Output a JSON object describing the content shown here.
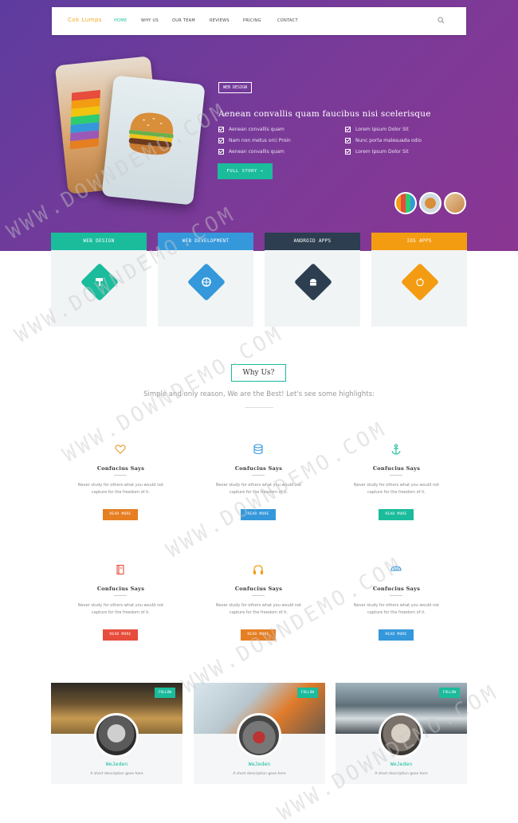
{
  "nav": {
    "logo": "Cok Lumps",
    "items": [
      "HOME",
      "WHY US",
      "OUR TEAM",
      "REVIEWS",
      "PRICING",
      "CONTACT"
    ]
  },
  "hero": {
    "tag": "WEB DESIGN",
    "title": "Aenean convallis quam faucibus nisi scelerisque",
    "list_left": [
      "Aenean convallis quam",
      "Nam non metus orci Proin",
      "Aenean convallis quam"
    ],
    "list_right": [
      "Lorem Ipsum Dolor Sit",
      "Nunc porta malesuada odio",
      "Lorem Ipsum Dolor Sit"
    ],
    "button": "FULL STORY"
  },
  "services": [
    {
      "label": "WEB DESIGN",
      "color": "#1abc9c",
      "icon": "paint-roller-icon"
    },
    {
      "label": "WEB DEVELOPMENT",
      "color": "#3498db",
      "icon": "globe-icon"
    },
    {
      "label": "ANDROID APPS",
      "color": "#2c3e50",
      "icon": "android-icon"
    },
    {
      "label": "IOS APPS",
      "color": "#f39c12",
      "icon": "apple-icon"
    }
  ],
  "why": {
    "title": "Why Us?",
    "subtitle": "Simple and only reason, We are the Best! Let's see some highlights:"
  },
  "features": [
    {
      "title": "Confucius Says",
      "text": "Never study for others what you would not capture for the freedom of it.",
      "button": "READ MORE",
      "color": "#e67e22",
      "icon": "heart-icon"
    },
    {
      "title": "Confucius Says",
      "text": "Never study for others what you would not capture for the freedom of it.",
      "button": "READ MORE",
      "color": "#3498db",
      "icon": "database-icon"
    },
    {
      "title": "Confucius Says",
      "text": "Never study for others what you would not capture for the freedom of it.",
      "button": "READ MORE",
      "color": "#1abc9c",
      "icon": "anchor-icon"
    },
    {
      "title": "Confucius Says",
      "text": "Never study for others what you would not capture for the freedom of it.",
      "button": "READ MORE",
      "color": "#e74c3c",
      "icon": "book-icon"
    },
    {
      "title": "Confucius Says",
      "text": "Never study for others what you would not capture for the freedom of it.",
      "button": "READ MORE",
      "color": "#e67e22",
      "icon": "headphones-icon"
    },
    {
      "title": "Confucius Says",
      "text": "Never study for others what you would not capture for the freedom of it.",
      "button": "READ MORE",
      "color": "#3498db",
      "icon": "umbrella-icon"
    }
  ],
  "team": [
    {
      "name": "WeJeden",
      "desc": "A short description goes here",
      "follow": "FOLLOW"
    },
    {
      "name": "WeJeden",
      "desc": "A short description goes here",
      "follow": "FOLLOW"
    },
    {
      "name": "WeJeden",
      "desc": "A short description goes here",
      "follow": "FOLLOW"
    }
  ],
  "watermark": "WWW.DOWNDEMO.COM"
}
